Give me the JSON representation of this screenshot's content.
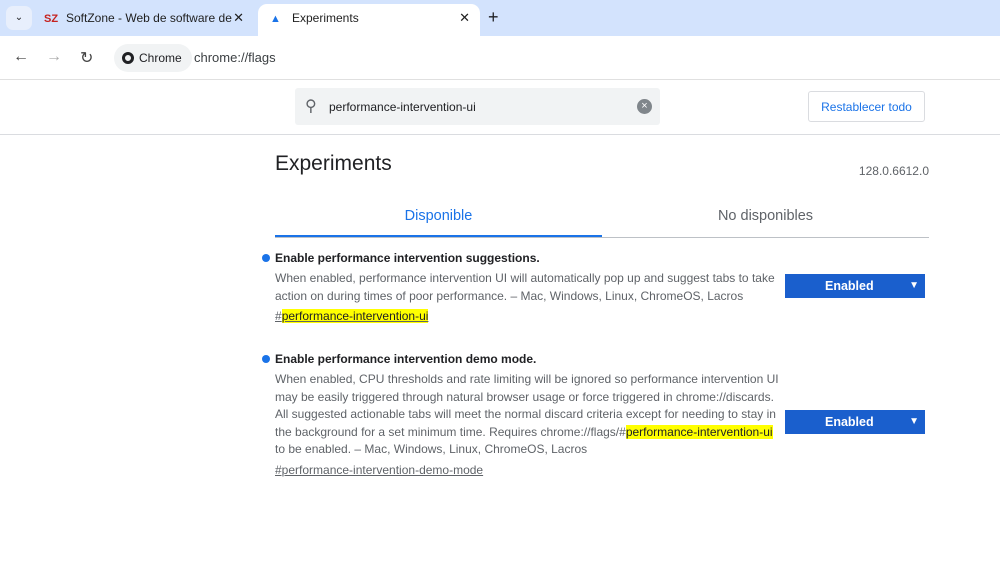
{
  "browser": {
    "tabs": [
      {
        "title": "SoftZone - Web de software de",
        "favicon": "softzone-logo-icon"
      },
      {
        "title": "Experiments",
        "favicon": "flask-icon",
        "active": true
      }
    ],
    "chip_label": "Chrome",
    "url": "chrome://flags"
  },
  "header": {
    "search_value": "performance-intervention-ui",
    "reset_label": "Restablecer todo"
  },
  "main": {
    "title": "Experiments",
    "version": "128.0.6612.0",
    "tabs": [
      {
        "label": "Disponible",
        "active": true
      },
      {
        "label": "No disponibles"
      }
    ],
    "experiments": [
      {
        "name": "Enable performance intervention suggestions.",
        "desc_a": "When enabled, performance intervention UI will automatically pop up and suggest tabs to take action on during times of poor performance. – Mac, Windows, Linux, ChromeOS, Lacros",
        "link_prefix": "#",
        "link_hl": "performance-intervention-ui",
        "state": "Enabled"
      },
      {
        "name": "Enable performance intervention demo mode.",
        "desc_a": "When enabled, CPU thresholds and rate limiting will be ignored so performance intervention UI may be easily triggered through natural browser usage or force triggered in chrome://discards. All suggested actionable tabs will meet the normal discard criteria except for needing to stay in the background for a set minimum time. Requires chrome://flags/#",
        "desc_hl": "performance-intervention-ui",
        "desc_b": " to be enabled. – Mac, Windows, Linux, ChromeOS, Lacros",
        "link": "#performance-intervention-demo-mode",
        "state": "Enabled"
      }
    ]
  },
  "colors": {
    "accent": "#1a73e8",
    "select_bg": "#1a5fcd",
    "highlight": "#ffff00",
    "tabbar": "#d3e3fd"
  }
}
